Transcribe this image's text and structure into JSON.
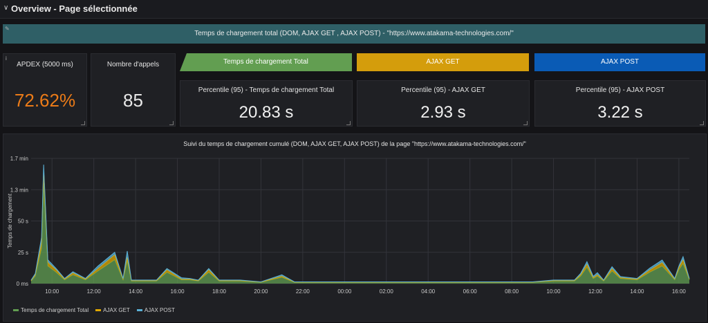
{
  "row": {
    "title": "Overview - Page sélectionnée"
  },
  "banner": {
    "text": "Temps de chargement total (DOM, AJAX GET , AJAX POST) - \"https://www.atakama-technologies.com/\""
  },
  "apdex": {
    "title": "APDEX (5000 ms)",
    "value": "72.62%"
  },
  "calls": {
    "title": "Nombre d'appels",
    "value": "85"
  },
  "headers": {
    "total": "Temps de chargement Total",
    "get": "AJAX GET",
    "post": "AJAX POST"
  },
  "percentiles": {
    "total": {
      "title": "Percentile (95) - Temps de chargement Total",
      "value": "20.83 s"
    },
    "get": {
      "title": "Percentile (95) - AJAX GET",
      "value": "2.93 s"
    },
    "post": {
      "title": "Percentile (95) - AJAX POST",
      "value": "3.22 s"
    }
  },
  "colors": {
    "total": "#629e51",
    "get": "#e0a800",
    "post": "#1f6fc5",
    "apdex": "#eb7b18",
    "banner": "#2f5f66"
  },
  "chart_data": {
    "type": "area",
    "title": "Suivi du temps de chargement cumulé (DOM, AJAX GET, AJAX POST) de la page \"https://www.atakama-technologies.com/\"",
    "ylabel": "Temps de chargement",
    "ytick_labels": [
      "0 ms",
      "25 s",
      "50 s",
      "1.3 min",
      "1.7 min"
    ],
    "ylim": [
      0,
      100
    ],
    "xtick_labels": [
      "10:00",
      "12:00",
      "14:00",
      "16:00",
      "18:00",
      "20:00",
      "22:00",
      "00:00",
      "02:00",
      "04:00",
      "06:00",
      "08:00",
      "10:00",
      "12:00",
      "14:00",
      "16:00"
    ],
    "xlim": [
      0,
      31.5
    ],
    "x": [
      0,
      0.2,
      0.5,
      0.6,
      0.8,
      1.2,
      1.6,
      2.0,
      2.6,
      3.2,
      4.0,
      4.4,
      4.6,
      4.8,
      5.2,
      6.0,
      6.5,
      7.2,
      7.6,
      8.0,
      8.5,
      9.0,
      9.6,
      10.0,
      11.0,
      12.0,
      12.6,
      13.0,
      13.6,
      14.0,
      16.0,
      18.0,
      20.0,
      22.0,
      23.0,
      23.6,
      24.0,
      25.0,
      26.0,
      26.3,
      26.6,
      26.9,
      27.1,
      27.4,
      27.8,
      28.2,
      29.0,
      29.6,
      30.2,
      30.8,
      31.0,
      31.2,
      31.5
    ],
    "series": [
      {
        "name": "Temps de chargement Total",
        "color": "#629e51",
        "values": [
          2,
          6,
          28,
          80,
          14,
          9,
          3,
          7,
          3,
          10,
          19,
          3,
          18,
          2,
          2,
          2,
          9,
          3,
          3,
          2,
          9,
          2,
          2,
          2,
          1,
          5,
          1,
          1,
          1,
          1,
          1,
          1,
          1,
          1,
          1,
          1,
          1,
          2,
          2,
          6,
          13,
          4,
          6,
          2,
          10,
          4,
          3,
          9,
          14,
          3,
          11,
          16,
          3
        ]
      },
      {
        "name": "AJAX GET",
        "color": "#e0a800",
        "values": [
          0.4,
          1,
          5,
          12,
          3,
          2,
          0.6,
          1.5,
          0.6,
          2,
          4,
          0.6,
          3,
          0.4,
          0.4,
          0.4,
          2,
          0.6,
          0.6,
          0.4,
          2,
          0.4,
          0.4,
          0.4,
          0.2,
          1,
          0.2,
          0.2,
          0.2,
          0.2,
          0.2,
          0.2,
          0.2,
          0.2,
          0.2,
          0.2,
          0.2,
          0.4,
          0.4,
          1.2,
          2.5,
          0.8,
          1.2,
          0.4,
          2,
          0.8,
          0.6,
          1.8,
          2.8,
          0.6,
          2,
          3,
          0.6
        ]
      },
      {
        "name": "AJAX POST",
        "color": "#5ab0d6",
        "values": [
          0.4,
          1,
          4,
          3,
          2,
          1,
          0.5,
          1,
          0.5,
          2,
          2,
          0.5,
          5,
          0.4,
          0.4,
          0.4,
          1,
          1,
          0.5,
          0.4,
          1,
          0.4,
          0.4,
          0.4,
          0.2,
          1,
          0.2,
          0.2,
          0.2,
          0.2,
          0.2,
          0.2,
          0.2,
          0.2,
          0.2,
          0.2,
          0.2,
          0.4,
          0.4,
          1,
          2,
          1,
          1.5,
          0.4,
          1.5,
          0.8,
          0.5,
          1.5,
          2,
          0.5,
          1,
          2.5,
          0.5
        ]
      }
    ]
  }
}
